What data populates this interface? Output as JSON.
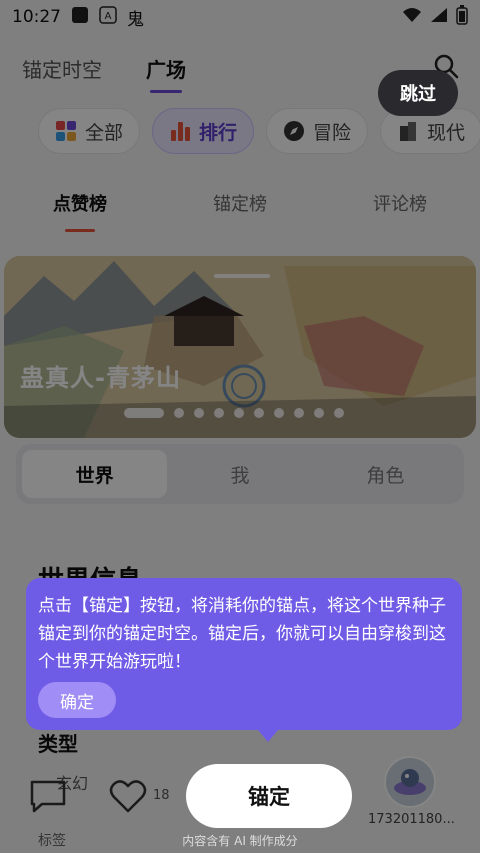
{
  "status_bar": {
    "time": "10:27",
    "app_glyph": "鬼"
  },
  "top_tabs": [
    {
      "label": "锚定时空",
      "active": false
    },
    {
      "label": "广场",
      "active": true
    }
  ],
  "chips": [
    {
      "label": "全部",
      "icon": "grid-icon",
      "active": false
    },
    {
      "label": "排行",
      "icon": "bar-chart-icon",
      "active": true
    },
    {
      "label": "冒险",
      "icon": "compass-icon",
      "active": false
    },
    {
      "label": "现代",
      "icon": "building-icon",
      "active": false
    }
  ],
  "rank_tabs": [
    {
      "label": "点赞榜",
      "active": true
    },
    {
      "label": "锚定榜",
      "active": false
    },
    {
      "label": "评论榜",
      "active": false
    }
  ],
  "banner": {
    "title": "蛊真人-青茅山",
    "dot_count": 10,
    "active_dot": 0
  },
  "segment": [
    {
      "label": "世界",
      "active": true
    },
    {
      "label": "我",
      "active": false
    },
    {
      "label": "角色",
      "active": false
    }
  ],
  "section_title": "世界信息",
  "type_label": "类型",
  "type_tag": "玄幻",
  "footer_text": "标签",
  "like_count": "18",
  "user_id": "173201180...",
  "skip_label": "跳过",
  "tooltip": {
    "text": "点击【锚定】按钮，将消耗你的锚点，将这个世界种子锚定到你的锚定时空。锚定后，你就可以自由穿梭到这个世界开始游玩啦！",
    "ok_label": "确定"
  },
  "anchor_button": "锚定",
  "ai_note": "内容含有 AI 制作成分",
  "colors": {
    "accent": "#6e5ce6",
    "tab_underline": "#e8553a",
    "overlay": "rgba(0,0,0,0.48)"
  }
}
